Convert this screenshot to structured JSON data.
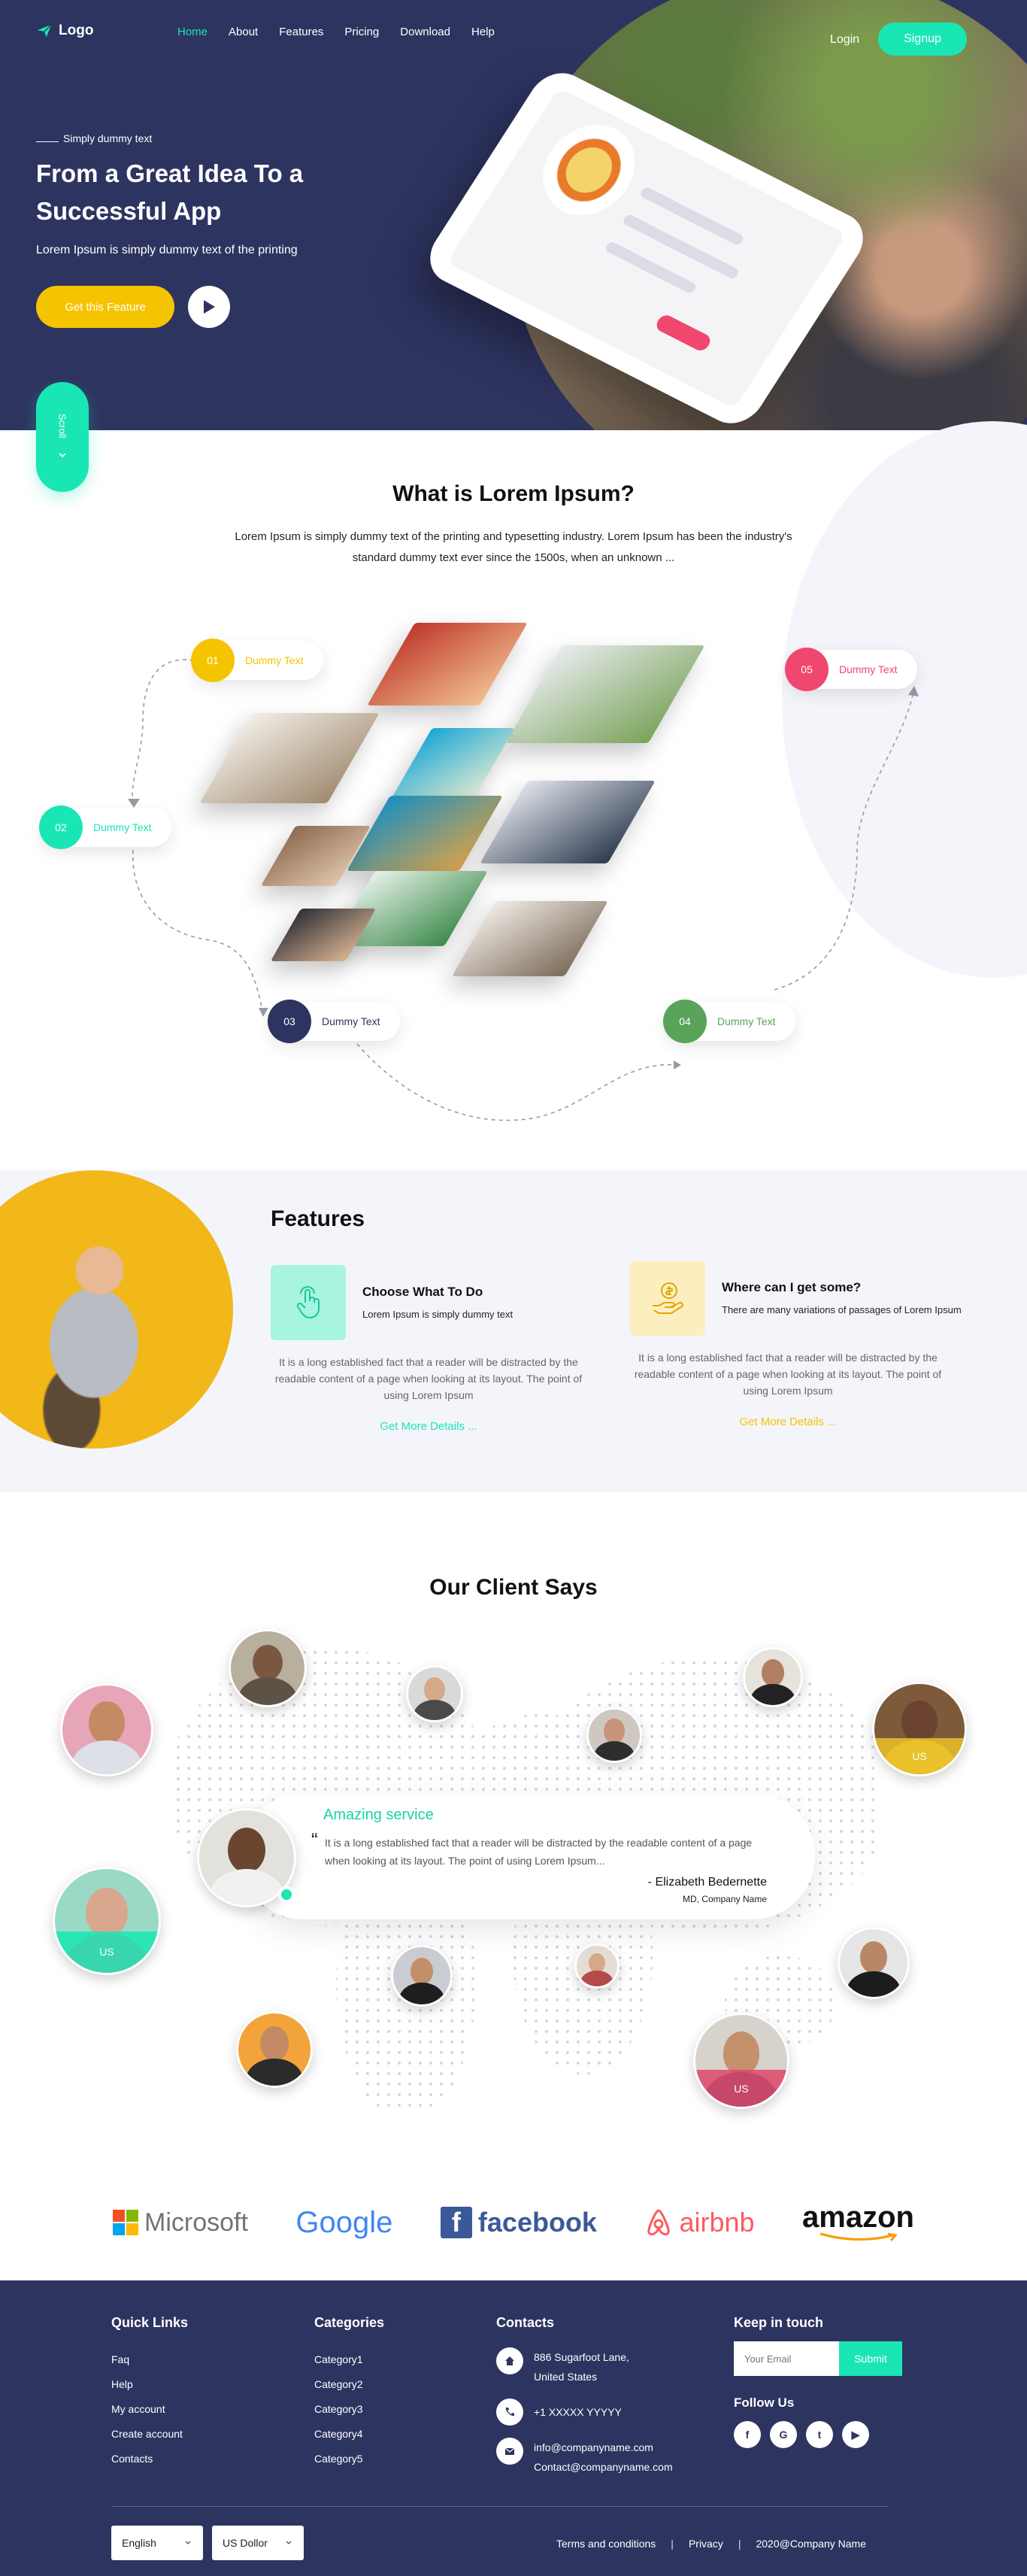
{
  "header": {
    "logo_text": "Logo",
    "nav": [
      "Home",
      "About",
      "Features",
      "Pricing",
      "Download",
      "Help"
    ],
    "active_nav": "Home",
    "login_label": "Login",
    "signup_label": "Signup"
  },
  "hero": {
    "kicker": "Simply dummy text",
    "title": "From a Great Idea To a Successful App",
    "subtitle": "Lorem Ipsum is simply dummy text of the printing",
    "cta_label": "Get this Feature",
    "scroll_label": "Scroll"
  },
  "what": {
    "title": "What is Lorem Ipsum?",
    "text": "Lorem Ipsum is simply dummy text of the printing and typesetting industry. Lorem Ipsum has been the industry's standard dummy text ever since the 1500s, when an unknown ...",
    "steps": [
      {
        "num": "01",
        "label": "Dummy Text",
        "color": "#f5c400"
      },
      {
        "num": "02",
        "label": "Dummy Text",
        "color": "#19e6b4"
      },
      {
        "num": "03",
        "label": "Dummy Text",
        "color": "#2e3460"
      },
      {
        "num": "04",
        "label": "Dummy Text",
        "color": "#5aa35a"
      },
      {
        "num": "05",
        "label": "Dummy Text",
        "color": "#f0476f"
      }
    ]
  },
  "features": {
    "title": "Features",
    "cards": [
      {
        "heading": "Choose What To Do",
        "short": "Lorem Ipsum is simply dummy text",
        "body": "It is a long established fact that a reader will be distracted by the readable content of a page when looking at its layout. The point of using Lorem Ipsum",
        "more": "Get More Details ...",
        "accent": "#19e6b4",
        "icon": "touch-icon"
      },
      {
        "heading": "Where can I get some?",
        "short": "There are many variations of passages of Lorem Ipsum",
        "body": "It is a long established fact that a reader will be distracted by the readable content of a page when looking at its layout. The point of using Lorem Ipsum",
        "more": "Get More Details ...",
        "accent": "#f5c400",
        "icon": "money-hand-icon"
      }
    ]
  },
  "clients": {
    "title": "Our Client Says",
    "testimonial": {
      "heading": "Amazing service",
      "quote": "It is a long established fact that a reader will be distracted by the readable content of a page when looking at its layout. The point of using Lorem Ipsum...",
      "author": "- Elizabeth Bedernette",
      "role": "MD, Company Name"
    },
    "country_tags": [
      "US",
      "US",
      "US"
    ]
  },
  "brands": [
    "Microsoft",
    "Google",
    "facebook",
    "airbnb",
    "amazon"
  ],
  "footer": {
    "quick_links": {
      "title": "Quick Links",
      "items": [
        "Faq",
        "Help",
        "My account",
        "Create account",
        "Contacts"
      ]
    },
    "categories": {
      "title": "Categories",
      "items": [
        "Category1",
        "Category2",
        "Category3",
        "Category4",
        "Category5"
      ]
    },
    "contacts": {
      "title": "Contacts",
      "address_line1": "886  Sugarfoot Lane,",
      "address_line2": "United States",
      "phone": "+1 XXXXX YYYYY",
      "email1": "info@companyname.com",
      "email2": "Contact@companyname.com"
    },
    "keep_in_touch": {
      "title": "Keep in touch",
      "placeholder": "Your Email",
      "submit_label": "Submit"
    },
    "follow": {
      "title": "Follow Us",
      "icons": [
        "f",
        "G",
        "t",
        "▶"
      ]
    },
    "language": "English",
    "currency": "US Dollor",
    "bottom_links": [
      "Terms and conditions",
      "Privacy",
      "2020@Company Name"
    ]
  },
  "colors": {
    "navy": "#2e3460",
    "mint": "#19e6b4",
    "yellow": "#f5c400",
    "pink": "#f0476f",
    "green": "#5aa35a"
  }
}
